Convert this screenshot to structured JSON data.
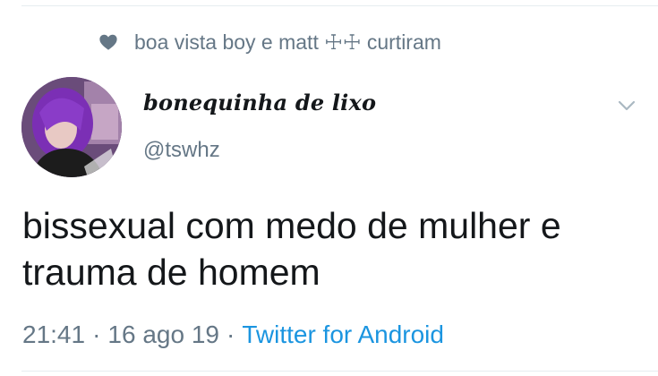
{
  "social_context": {
    "icon": "heart-icon",
    "text": "boa vista boy e matt ☩☩ curtiram"
  },
  "author": {
    "display_name": "bonequinha de lixo",
    "handle": "@tswhz",
    "avatar": "profile-photo"
  },
  "menu": {
    "icon": "chevron-down-icon"
  },
  "tweet": {
    "lines": [
      "bissexual com medo de mulher e",
      "trauma de homem"
    ]
  },
  "meta": {
    "time": "21:41",
    "separator": "·",
    "date": "16 ago 19",
    "source": "Twitter for Android"
  },
  "colors": {
    "text": "#14171a",
    "secondary": "#657786",
    "link": "#1b95e0",
    "divider": "#e6ecf0"
  }
}
